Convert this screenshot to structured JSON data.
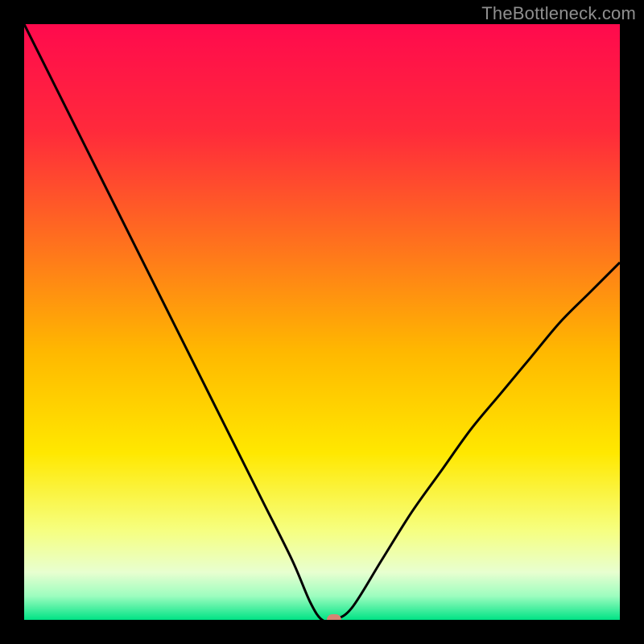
{
  "watermark": "TheBottleneck.com",
  "chart_data": {
    "type": "line",
    "title": "",
    "xlabel": "",
    "ylabel": "",
    "xlim": [
      0,
      100
    ],
    "ylim": [
      0,
      100
    ],
    "x": [
      0,
      5,
      10,
      15,
      20,
      25,
      30,
      35,
      40,
      45,
      48,
      50,
      52,
      55,
      60,
      65,
      70,
      75,
      80,
      85,
      90,
      95,
      100
    ],
    "values": [
      100,
      90,
      80,
      70,
      60,
      50,
      40,
      30,
      20,
      10,
      3,
      0,
      0,
      2,
      10,
      18,
      25,
      32,
      38,
      44,
      50,
      55,
      60
    ],
    "marker": {
      "x": 52,
      "y": 0,
      "color": "#d68473"
    },
    "gradient_stops": [
      {
        "pos": 0,
        "color": "#ff0a4d"
      },
      {
        "pos": 18,
        "color": "#ff2a3b"
      },
      {
        "pos": 36,
        "color": "#ff6e1f"
      },
      {
        "pos": 55,
        "color": "#ffb800"
      },
      {
        "pos": 72,
        "color": "#ffe800"
      },
      {
        "pos": 85,
        "color": "#f6ff80"
      },
      {
        "pos": 92,
        "color": "#e8ffd0"
      },
      {
        "pos": 96,
        "color": "#9dfdbf"
      },
      {
        "pos": 100,
        "color": "#00e385"
      }
    ]
  }
}
